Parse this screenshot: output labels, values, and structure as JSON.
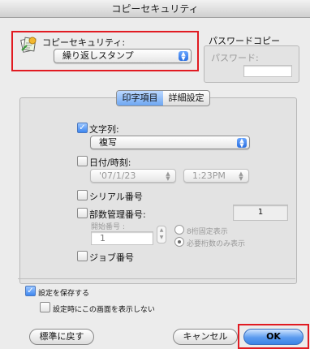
{
  "window": {
    "title": "コピーセキュリティ"
  },
  "copy_security": {
    "label": "コピーセキュリティ:",
    "selected": "繰り返しスタンプ"
  },
  "password_copy": {
    "group_label": "パスワードコピー",
    "password_label": "パスワード:",
    "password_value": ""
  },
  "tabs": [
    {
      "label": "印字項目",
      "active": true
    },
    {
      "label": "詳細設定",
      "active": false
    }
  ],
  "print_items": {
    "text_string": {
      "label": "文字列:",
      "checked": true,
      "selected": "複写"
    },
    "date_time": {
      "label": "日付/時刻:",
      "checked": false,
      "date": "'07/1/23",
      "time": "1:23PM"
    },
    "serial_number": {
      "label": "シリアル番号",
      "checked": false
    },
    "copy_control_number": {
      "label": "部数管理番号:",
      "checked": false,
      "field_value": "1",
      "start_label": "開始番号 :",
      "start_value": "1",
      "radio_fixed": "8桁固定表示",
      "radio_needed": "必要桁数のみ表示",
      "selected_radio": "必要桁数のみ表示"
    },
    "job_number": {
      "label": "ジョブ番号",
      "checked": false
    }
  },
  "save_settings": {
    "label": "設定を保存する",
    "checked": true
  },
  "dont_show": {
    "label": "設定時にこの画面を表示しない",
    "checked": false
  },
  "buttons": {
    "defaults": "標準に戻す",
    "cancel": "キャンセル",
    "ok": "OK"
  },
  "colors": {
    "highlight_red": "#e11b22",
    "accent_blue": "#3d84e6"
  }
}
